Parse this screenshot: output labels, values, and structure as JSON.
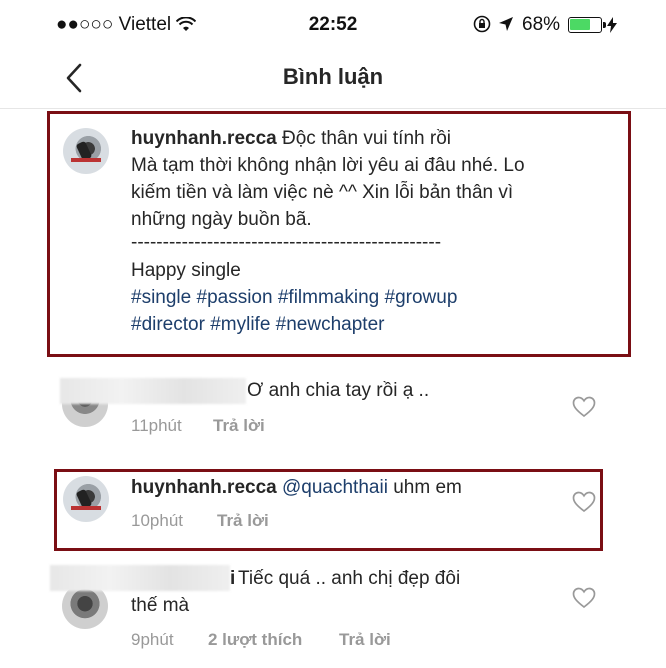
{
  "status_bar": {
    "carrier": "●●○○○ Viettel",
    "time": "22:52",
    "battery": "68%"
  },
  "header": {
    "title": "Bình luận"
  },
  "caption": {
    "username": "huynhanh.recca",
    "line1_text": "Độc thân vui tính rồi",
    "line2": "Mà tạm thời không nhận lời yêu ai đâu nhé. Lo",
    "line3": "kiếm tiền và làm việc nè ^^ Xin lỗi bản thân vì",
    "line4": "những ngày buồn bã.",
    "separator": "-------------------------------------------------",
    "line5": "Happy single",
    "hashtags_row1": [
      "#single",
      "#passion",
      "#filmmaking",
      "#growup"
    ],
    "hashtags_row2": [
      "#director",
      "#mylife",
      "#newchapter"
    ]
  },
  "comments": [
    {
      "text": "Ơ anh chia tay rồi ạ ..",
      "time": "11phút",
      "reply": "Trả lời"
    },
    {
      "username": "huynhanh.recca",
      "mention": "@quachthaii",
      "text": "uhm em",
      "time": "10phút",
      "reply": "Trả lời"
    },
    {
      "username_partial": "i",
      "text_line1": "Tiếc quá .. anh chị đẹp đôi",
      "text_line2": "thế mà",
      "time": "9phút",
      "likes": "2 lượt thích",
      "reply": "Trả lời"
    }
  ],
  "icons": {
    "back": "chevron-left-icon",
    "like": "heart-outline-icon",
    "wifi": "wifi-icon",
    "location": "location-arrow-icon",
    "lock": "rotation-lock-icon",
    "battery": "battery-icon",
    "charging": "charging-bolt-icon"
  },
  "colors": {
    "highlight_box": "#7a0e14",
    "hashtag": "#1d3e6b",
    "battery_fill": "#4cd964"
  }
}
